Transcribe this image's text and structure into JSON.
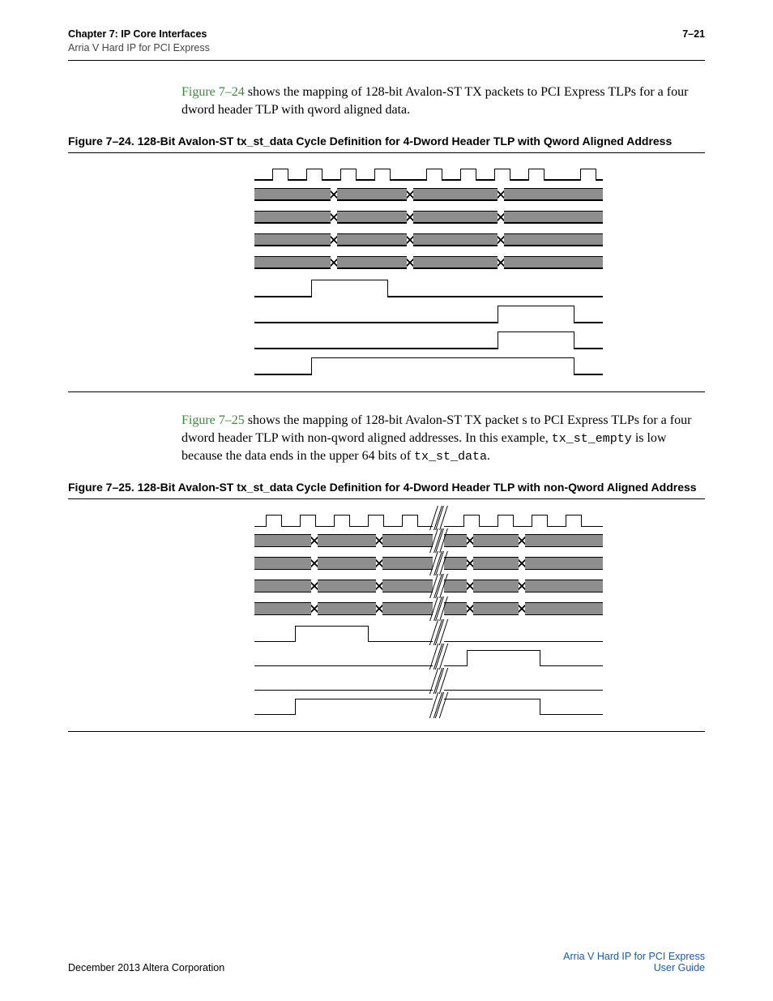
{
  "header": {
    "chapter": "Chapter 7:  IP Core Interfaces",
    "sub": "Arria V Hard IP for PCI Express",
    "pagenum": "7–21"
  },
  "para1": {
    "ref": "Figure 7–24",
    "text": " shows the mapping of 128-bit Avalon-ST TX packets to PCI Express TLPs for a four dword header TLP with qword aligned data."
  },
  "fig24_caption": "Figure 7–24.  128-Bit Avalon-ST tx_st_data Cycle Definition for 4-Dword Header TLP with Qword Aligned Address",
  "para2": {
    "ref": "Figure 7–25",
    "t1": " shows the mapping of 128-bit Avalon-ST TX packet s to PCI Express TLPs for a four dword header TLP with non-qword aligned addresses. In this example, ",
    "code1": "tx_st_empty",
    "t2": " is low because the data ends in the upper 64 bits of ",
    "code2": "tx_st_data",
    "t3": "."
  },
  "fig25_caption": "Figure 7–25.  128-Bit Avalon-ST tx_st_data Cycle Definition for 4-Dword Header TLP with non-Qword Aligned Address",
  "footer": {
    "left": "December 2013   Altera Corporation",
    "right1": "Arria V Hard IP for PCI Express",
    "right2": "User Guide"
  }
}
